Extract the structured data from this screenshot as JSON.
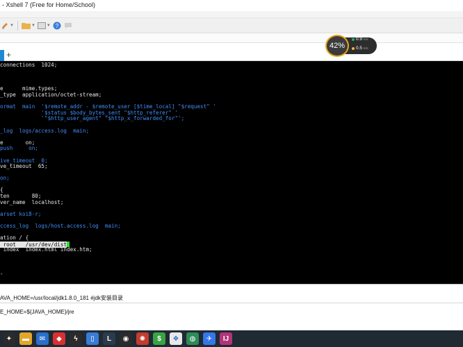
{
  "window": {
    "title": "- Xshell 7 (Free for Home/School)"
  },
  "toolbar": {
    "icons": [
      "edit-icon",
      "folder-icon",
      "panel-icon",
      "help-icon",
      "chat-icon"
    ]
  },
  "tabs": {
    "add_label": "+"
  },
  "terminal": {
    "lines": [
      {
        "text": "connections  1024;",
        "cls": ""
      },
      {
        "text": "",
        "cls": ""
      },
      {
        "text": "",
        "cls": ""
      },
      {
        "text": "",
        "cls": ""
      },
      {
        "text": "e      mime.types;",
        "cls": ""
      },
      {
        "text": "_type  application/octet-stream;",
        "cls": ""
      },
      {
        "text": "",
        "cls": ""
      },
      {
        "text": "ormat  main  '$remote_addr - $remote_user [$time_local] \"$request\" '",
        "cls": "c-blue"
      },
      {
        "text": "             '$status $body_bytes_sent \"$http_referer\" '",
        "cls": "c-blue"
      },
      {
        "text": "             '\"$http_user_agent\" \"$http_x_forwarded_for\"';",
        "cls": "c-blue"
      },
      {
        "text": "",
        "cls": ""
      },
      {
        "text": "_log  logs/access.log  main;",
        "cls": "c-blue"
      },
      {
        "text": "",
        "cls": ""
      },
      {
        "text": "e       on;",
        "cls": ""
      },
      {
        "text": "push     on;",
        "cls": "c-blue"
      },
      {
        "text": "",
        "cls": ""
      },
      {
        "text": "ive_timeout  0;",
        "cls": "c-blue"
      },
      {
        "text": "ve_timeout  65;",
        "cls": ""
      },
      {
        "text": "",
        "cls": ""
      },
      {
        "text": "on;",
        "cls": "c-blue"
      },
      {
        "text": "",
        "cls": ""
      },
      {
        "text": "{",
        "cls": ""
      },
      {
        "text": "ten       80;",
        "cls": ""
      },
      {
        "text": "ver_name  localhost;",
        "cls": ""
      },
      {
        "text": "",
        "cls": ""
      },
      {
        "text": "arset koi8-r;",
        "cls": "c-blue"
      },
      {
        "text": "",
        "cls": ""
      },
      {
        "text": "ccess_log  logs/host.access.log  main;",
        "cls": "c-blue"
      },
      {
        "text": "",
        "cls": ""
      },
      {
        "text": "ation / {",
        "cls": ""
      },
      {
        "text": "",
        "cls": "selected"
      },
      {
        "text": " index  index.html index.htm;",
        "cls": ""
      },
      {
        "text": "",
        "cls": ""
      },
      {
        "text": "",
        "cls": ""
      },
      {
        "text": "",
        "cls": ""
      },
      {
        "text": "-",
        "cls": ""
      }
    ],
    "selected_prefix": " root   /usr/dev/dist"
  },
  "status": {
    "line1": "AVA_HOME=/usr/local/jdk1.8.0_181  #jdk安装目录",
    "line2": "E_HOME=${JAVA_HOME}/jre"
  },
  "net_widget": {
    "percent": "42%",
    "upload_value": "0.9",
    "upload_unit": "K/s",
    "download_value": "0.5",
    "download_unit": "K/s",
    "upload_color": "#19b36b",
    "download_color": "#ffb33a"
  },
  "taskbar": {
    "apps": [
      {
        "name": "start-icon",
        "glyph": "✦",
        "bg": "#2b2b2b"
      },
      {
        "name": "file-explorer-icon",
        "glyph": "▬",
        "bg": "#e2a72a"
      },
      {
        "name": "mail-icon",
        "glyph": "✉",
        "bg": "#2a6fcc"
      },
      {
        "name": "app-red-icon",
        "glyph": "◆",
        "bg": "#d93030"
      },
      {
        "name": "terminal-icon",
        "glyph": "ϟ",
        "bg": "#2b2b2b"
      },
      {
        "name": "tablet-icon",
        "glyph": "▯",
        "bg": "#3a7bd5"
      },
      {
        "name": "game-icon",
        "glyph": "L",
        "bg": "#2b3b4b"
      },
      {
        "name": "chrome-icon",
        "glyph": "◉",
        "bg": "#2b2b2b"
      },
      {
        "name": "xshell-icon",
        "glyph": "✺",
        "bg": "#c33c2f"
      },
      {
        "name": "money-icon",
        "glyph": "$",
        "bg": "#3aa343"
      },
      {
        "name": "net-icon",
        "glyph": "❖",
        "bg": "#e8e8e8"
      },
      {
        "name": "browser-icon",
        "glyph": "◍",
        "bg": "#2e8b57"
      },
      {
        "name": "feishu-icon",
        "glyph": "✈",
        "bg": "#3577e8"
      },
      {
        "name": "idea-icon",
        "glyph": "IJ",
        "bg": "#b13478"
      }
    ]
  }
}
